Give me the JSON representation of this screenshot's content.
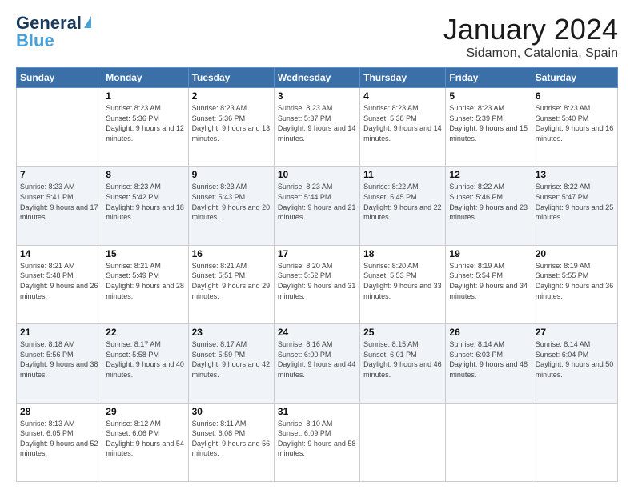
{
  "logo": {
    "line1": "General",
    "line2": "Blue"
  },
  "title": "January 2024",
  "subtitle": "Sidamon, Catalonia, Spain",
  "days_header": [
    "Sunday",
    "Monday",
    "Tuesday",
    "Wednesday",
    "Thursday",
    "Friday",
    "Saturday"
  ],
  "weeks": [
    [
      {
        "num": "",
        "sunrise": "",
        "sunset": "",
        "daylight": ""
      },
      {
        "num": "1",
        "sunrise": "Sunrise: 8:23 AM",
        "sunset": "Sunset: 5:36 PM",
        "daylight": "Daylight: 9 hours and 12 minutes."
      },
      {
        "num": "2",
        "sunrise": "Sunrise: 8:23 AM",
        "sunset": "Sunset: 5:36 PM",
        "daylight": "Daylight: 9 hours and 13 minutes."
      },
      {
        "num": "3",
        "sunrise": "Sunrise: 8:23 AM",
        "sunset": "Sunset: 5:37 PM",
        "daylight": "Daylight: 9 hours and 14 minutes."
      },
      {
        "num": "4",
        "sunrise": "Sunrise: 8:23 AM",
        "sunset": "Sunset: 5:38 PM",
        "daylight": "Daylight: 9 hours and 14 minutes."
      },
      {
        "num": "5",
        "sunrise": "Sunrise: 8:23 AM",
        "sunset": "Sunset: 5:39 PM",
        "daylight": "Daylight: 9 hours and 15 minutes."
      },
      {
        "num": "6",
        "sunrise": "Sunrise: 8:23 AM",
        "sunset": "Sunset: 5:40 PM",
        "daylight": "Daylight: 9 hours and 16 minutes."
      }
    ],
    [
      {
        "num": "7",
        "sunrise": "Sunrise: 8:23 AM",
        "sunset": "Sunset: 5:41 PM",
        "daylight": "Daylight: 9 hours and 17 minutes."
      },
      {
        "num": "8",
        "sunrise": "Sunrise: 8:23 AM",
        "sunset": "Sunset: 5:42 PM",
        "daylight": "Daylight: 9 hours and 18 minutes."
      },
      {
        "num": "9",
        "sunrise": "Sunrise: 8:23 AM",
        "sunset": "Sunset: 5:43 PM",
        "daylight": "Daylight: 9 hours and 20 minutes."
      },
      {
        "num": "10",
        "sunrise": "Sunrise: 8:23 AM",
        "sunset": "Sunset: 5:44 PM",
        "daylight": "Daylight: 9 hours and 21 minutes."
      },
      {
        "num": "11",
        "sunrise": "Sunrise: 8:22 AM",
        "sunset": "Sunset: 5:45 PM",
        "daylight": "Daylight: 9 hours and 22 minutes."
      },
      {
        "num": "12",
        "sunrise": "Sunrise: 8:22 AM",
        "sunset": "Sunset: 5:46 PM",
        "daylight": "Daylight: 9 hours and 23 minutes."
      },
      {
        "num": "13",
        "sunrise": "Sunrise: 8:22 AM",
        "sunset": "Sunset: 5:47 PM",
        "daylight": "Daylight: 9 hours and 25 minutes."
      }
    ],
    [
      {
        "num": "14",
        "sunrise": "Sunrise: 8:21 AM",
        "sunset": "Sunset: 5:48 PM",
        "daylight": "Daylight: 9 hours and 26 minutes."
      },
      {
        "num": "15",
        "sunrise": "Sunrise: 8:21 AM",
        "sunset": "Sunset: 5:49 PM",
        "daylight": "Daylight: 9 hours and 28 minutes."
      },
      {
        "num": "16",
        "sunrise": "Sunrise: 8:21 AM",
        "sunset": "Sunset: 5:51 PM",
        "daylight": "Daylight: 9 hours and 29 minutes."
      },
      {
        "num": "17",
        "sunrise": "Sunrise: 8:20 AM",
        "sunset": "Sunset: 5:52 PM",
        "daylight": "Daylight: 9 hours and 31 minutes."
      },
      {
        "num": "18",
        "sunrise": "Sunrise: 8:20 AM",
        "sunset": "Sunset: 5:53 PM",
        "daylight": "Daylight: 9 hours and 33 minutes."
      },
      {
        "num": "19",
        "sunrise": "Sunrise: 8:19 AM",
        "sunset": "Sunset: 5:54 PM",
        "daylight": "Daylight: 9 hours and 34 minutes."
      },
      {
        "num": "20",
        "sunrise": "Sunrise: 8:19 AM",
        "sunset": "Sunset: 5:55 PM",
        "daylight": "Daylight: 9 hours and 36 minutes."
      }
    ],
    [
      {
        "num": "21",
        "sunrise": "Sunrise: 8:18 AM",
        "sunset": "Sunset: 5:56 PM",
        "daylight": "Daylight: 9 hours and 38 minutes."
      },
      {
        "num": "22",
        "sunrise": "Sunrise: 8:17 AM",
        "sunset": "Sunset: 5:58 PM",
        "daylight": "Daylight: 9 hours and 40 minutes."
      },
      {
        "num": "23",
        "sunrise": "Sunrise: 8:17 AM",
        "sunset": "Sunset: 5:59 PM",
        "daylight": "Daylight: 9 hours and 42 minutes."
      },
      {
        "num": "24",
        "sunrise": "Sunrise: 8:16 AM",
        "sunset": "Sunset: 6:00 PM",
        "daylight": "Daylight: 9 hours and 44 minutes."
      },
      {
        "num": "25",
        "sunrise": "Sunrise: 8:15 AM",
        "sunset": "Sunset: 6:01 PM",
        "daylight": "Daylight: 9 hours and 46 minutes."
      },
      {
        "num": "26",
        "sunrise": "Sunrise: 8:14 AM",
        "sunset": "Sunset: 6:03 PM",
        "daylight": "Daylight: 9 hours and 48 minutes."
      },
      {
        "num": "27",
        "sunrise": "Sunrise: 8:14 AM",
        "sunset": "Sunset: 6:04 PM",
        "daylight": "Daylight: 9 hours and 50 minutes."
      }
    ],
    [
      {
        "num": "28",
        "sunrise": "Sunrise: 8:13 AM",
        "sunset": "Sunset: 6:05 PM",
        "daylight": "Daylight: 9 hours and 52 minutes."
      },
      {
        "num": "29",
        "sunrise": "Sunrise: 8:12 AM",
        "sunset": "Sunset: 6:06 PM",
        "daylight": "Daylight: 9 hours and 54 minutes."
      },
      {
        "num": "30",
        "sunrise": "Sunrise: 8:11 AM",
        "sunset": "Sunset: 6:08 PM",
        "daylight": "Daylight: 9 hours and 56 minutes."
      },
      {
        "num": "31",
        "sunrise": "Sunrise: 8:10 AM",
        "sunset": "Sunset: 6:09 PM",
        "daylight": "Daylight: 9 hours and 58 minutes."
      },
      {
        "num": "",
        "sunrise": "",
        "sunset": "",
        "daylight": ""
      },
      {
        "num": "",
        "sunrise": "",
        "sunset": "",
        "daylight": ""
      },
      {
        "num": "",
        "sunrise": "",
        "sunset": "",
        "daylight": ""
      }
    ]
  ]
}
